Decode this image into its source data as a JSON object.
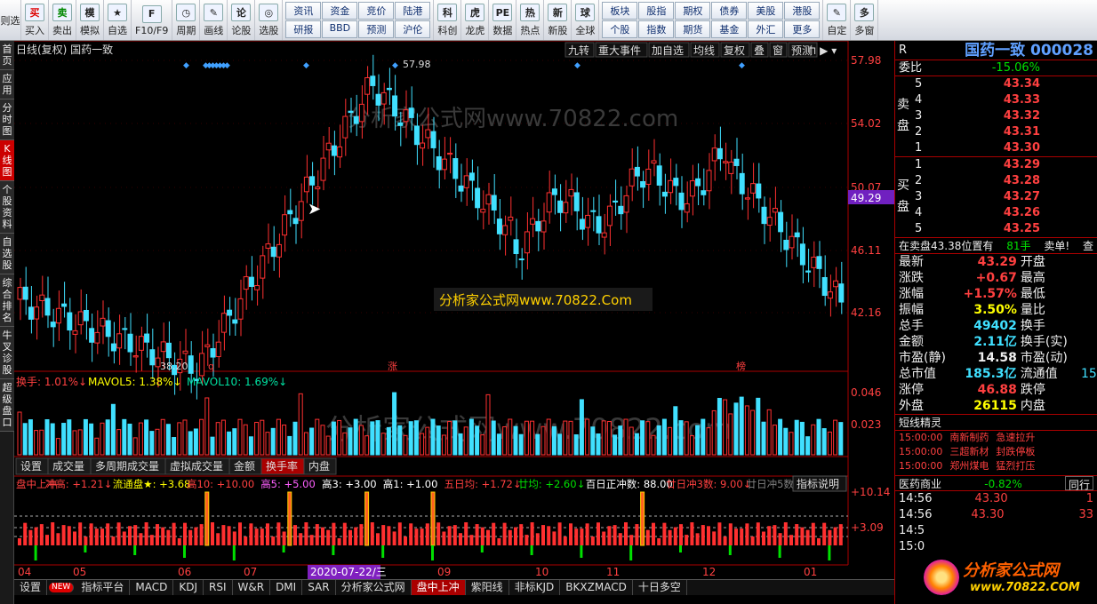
{
  "toolbar": {
    "items": [
      [
        "买",
        "买入"
      ],
      [
        "卖",
        "卖出"
      ],
      [
        "模",
        "模拟"
      ],
      [
        "★",
        "自选"
      ],
      [
        "F",
        "F10/F9"
      ],
      [
        "◷",
        "周期"
      ],
      [
        "✎",
        "画线"
      ],
      [
        "论",
        "论股"
      ],
      [
        "◎",
        "选股"
      ]
    ],
    "grid1": [
      "资讯",
      "研报",
      "资金",
      "BBD",
      "竞价",
      "预测",
      "陆港",
      "沪伦"
    ],
    "items2": [
      [
        "科",
        "科创"
      ],
      [
        "虎",
        "龙虎"
      ],
      [
        "PE",
        "数据"
      ],
      [
        "热",
        "热点"
      ],
      [
        "新",
        "新股"
      ],
      [
        "球",
        "全球"
      ]
    ],
    "grid2": [
      "板块",
      "个股",
      "股指",
      "指数",
      "期权",
      "期货",
      "债券",
      "基金",
      "美股",
      "外汇",
      "港股",
      "更多"
    ],
    "items3": [
      [
        "✎",
        "自定"
      ],
      [
        "多",
        "多窗"
      ]
    ],
    "corner": "则选"
  },
  "lefttabs": [
    "首页",
    "应用",
    "分时图",
    "K线图",
    "个股资料",
    "自选股",
    "综合排名",
    "牛叉诊股",
    "超级盘口"
  ],
  "chart_header": {
    "left": "日线(复权) 国药一致",
    "buttons": [
      "九转",
      "重大事件",
      "加自选",
      "均线",
      "复权",
      "叠",
      "窗",
      "预测"
    ]
  },
  "price_axis": [
    "57.98",
    "54.02",
    "50.07",
    "46.11",
    "42.16"
  ],
  "current_price_tag": "49.29",
  "high_label": "57.98",
  "low_label": "38.20",
  "markers": [
    "q",
    "涨",
    "榜"
  ],
  "watermark1": "分析家公式网www.70822.com",
  "watermark2": "分析家公式网www.70822.Com",
  "watermark3": "分析家公式网www.70822.com",
  "vol_header": [
    {
      "t": "换手: 1.01%↓",
      "c": "#ff4040"
    },
    {
      "t": "MAVOL5: 1.38%↓",
      "c": "#ffff00"
    },
    {
      "t": "MAVOL10: 1.69%↓",
      "c": "#00e0a0"
    }
  ],
  "vol_axis": [
    "0.046",
    "0.023"
  ],
  "vol_tabs": [
    "设置",
    "成交量",
    "多周期成交量",
    "虚拟成交量",
    "金额",
    "换手率",
    "内盘"
  ],
  "ind_header": [
    {
      "t": "盘中上冲",
      "c": "#ff4040"
    },
    {
      "t": "冲高: +1.21↓",
      "c": "#ff4040"
    },
    {
      "t": "流通盘★: +3.68",
      "c": "#ffff00"
    },
    {
      "t": "高10: +10.00",
      "c": "#ff4040"
    },
    {
      "t": "高5: +5.00",
      "c": "#ff60ff"
    },
    {
      "t": "高3: +3.00",
      "c": "#ffffff"
    },
    {
      "t": "高1: +1.00",
      "c": "#ffffff"
    },
    {
      "t": "五日均: +1.72↓",
      "c": "#ff4040"
    },
    {
      "t": "廿均: +2.60↓",
      "c": "#00e000"
    },
    {
      "t": "百日正冲数: 88.00",
      "c": "#ffffff"
    },
    {
      "t": "廿日冲3数: 9.00↓",
      "c": "#ff4040"
    },
    {
      "t": "廿日冲5数:",
      "c": "#808080"
    }
  ],
  "ind_btn": "指标说明",
  "ind_axis": [
    "+10.14",
    "+3.09"
  ],
  "months": [
    "04",
    "05",
    "06",
    "07",
    "08",
    "09",
    "10",
    "11",
    "12",
    "01"
  ],
  "date_highlight": "2020-07-22/三",
  "bottom_tabs": [
    "设置",
    "NEW",
    "指标平台",
    "MACD",
    "KDJ",
    "RSI",
    "W&R",
    "DMI",
    "SAR",
    "分析家公式网",
    "盘中上冲",
    "紫阳线",
    "非标KJD",
    "BKXZMACD",
    "十日多空"
  ],
  "quote": {
    "flag": "R",
    "name": "国药一致",
    "code": "000028",
    "weibi_label": "委比",
    "weibi": "-15.06%",
    "sell": [
      [
        "5",
        "43.34"
      ],
      [
        "4",
        "43.33"
      ],
      [
        "3",
        "43.32"
      ],
      [
        "2",
        "43.31"
      ],
      [
        "1",
        "43.30"
      ]
    ],
    "buy": [
      [
        "1",
        "43.29"
      ],
      [
        "2",
        "43.28"
      ],
      [
        "3",
        "43.27"
      ],
      [
        "4",
        "43.26"
      ],
      [
        "5",
        "43.25"
      ]
    ],
    "sell_side": "卖盘",
    "buy_side": "买盘",
    "notice": "在卖盘43.38位置有",
    "notice_qty": "81手",
    "notice_tag": "卖单!",
    "notice_tail": "查",
    "stats": [
      [
        "最新",
        "43.29",
        "开盘",
        ""
      ],
      [
        "涨跌",
        "+0.67",
        "最高",
        ""
      ],
      [
        "涨幅",
        "+1.57%",
        "最低",
        ""
      ],
      [
        "振幅",
        "3.50%",
        "量比",
        ""
      ],
      [
        "总手",
        "49402",
        "换手",
        ""
      ],
      [
        "金额",
        "2.11亿",
        "换手(实)",
        ""
      ],
      [
        "市盈(静)",
        "14.58",
        "市盈(动)",
        ""
      ],
      [
        "总市值",
        "185.3亿",
        "流通值",
        "15"
      ],
      [
        "涨停",
        "46.88",
        "跌停",
        ""
      ],
      [
        "外盘",
        "26115",
        "内盘",
        ""
      ]
    ],
    "elf_title": "短线精灵",
    "elf": [
      [
        "15:00:00",
        "南新制药",
        "急速拉升"
      ],
      [
        "15:00:00",
        "三超新材",
        "封跌停板"
      ],
      [
        "15:00:00",
        "郑州煤电",
        "猛烈打压"
      ]
    ],
    "sector": "医药商业",
    "sector_pct": "-0.82%",
    "sector_btn": "同行",
    "ticks": [
      [
        "14:56",
        "43.30",
        "1"
      ],
      [
        "14:56",
        "43.30",
        "33"
      ],
      [
        "14:5",
        ""
      ],
      [
        "15:0",
        ""
      ]
    ]
  },
  "brand": "分析家公式网",
  "brand_url": "www.70822.COM"
}
